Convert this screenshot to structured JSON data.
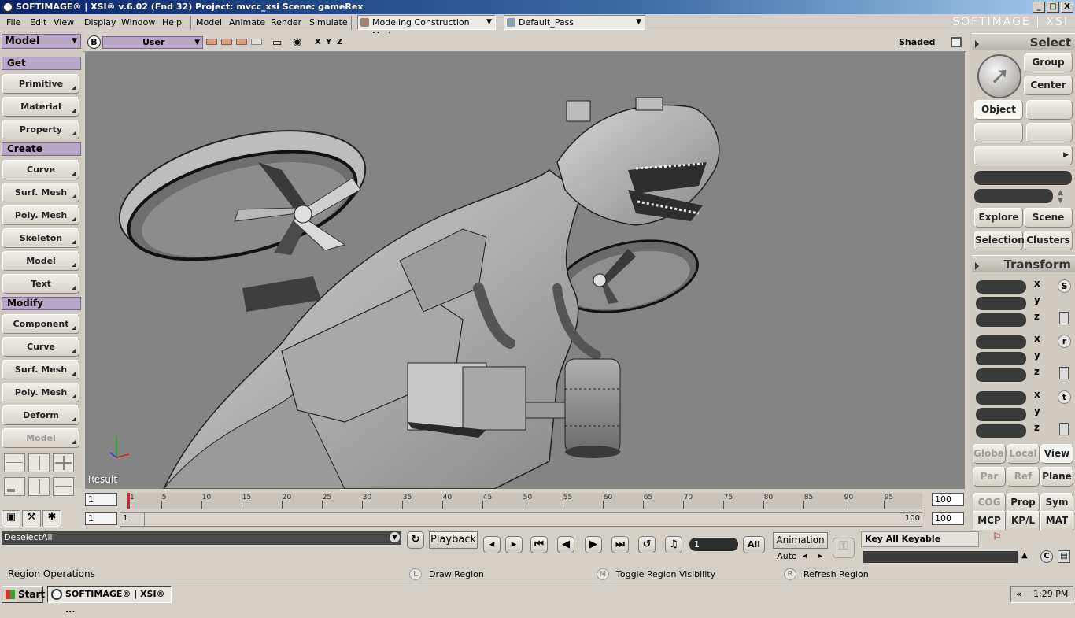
{
  "window": {
    "title": "SOFTIMAGE® | XSI® v.6.02 (Fnd 32) Project: mvcc_xsi    Scene: gameRex",
    "logo": "SOFTIMAGE | XSI",
    "minimize": "_",
    "maximize": "□",
    "close": "X"
  },
  "menubar": {
    "items": [
      "File",
      "Edit",
      "View",
      "Display",
      "Window",
      "Help",
      "Model",
      "Animate",
      "Render",
      "Simulate"
    ],
    "mode": "Modeling Construction Mode",
    "pass": "Default_Pass"
  },
  "left_panel": {
    "module": "Model",
    "sections": {
      "get": "Get",
      "create": "Create",
      "modify": "Modify"
    },
    "get_items": [
      "Primitive",
      "Material",
      "Property"
    ],
    "create_items": [
      "Curve",
      "Surf. Mesh",
      "Poly. Mesh",
      "Skeleton",
      "Model",
      "Text"
    ],
    "modify_items": [
      "Component",
      "Curve",
      "Surf. Mesh",
      "Poly. Mesh",
      "Deform",
      "Model"
    ]
  },
  "viewport": {
    "badge": "B",
    "camera": "User",
    "axes": [
      "X",
      "Y",
      "Z"
    ],
    "display_mode": "Shaded",
    "result_label": "Result"
  },
  "right_panel": {
    "select_title": "Select",
    "group": "Group",
    "center": "Center",
    "object": "Object",
    "explore": "Explore",
    "scene": "Scene",
    "selection": "Selection",
    "clusters": "Clusters",
    "transform_title": "Transform",
    "axes": [
      "x",
      "y",
      "z"
    ],
    "scale_icon": "S",
    "rotate_icon": "r",
    "translate_icon": "t",
    "global": "Global",
    "local": "Local",
    "view": "View",
    "par": "Par",
    "ref": "Ref",
    "plane": "Plane",
    "cog": "COG",
    "prop": "Prop",
    "sym": "Sym",
    "mcp": "MCP",
    "kpl": "KP/L",
    "mat": "MAT"
  },
  "timeline": {
    "start_frame": "1",
    "current_frame": "1",
    "end_frame": "100",
    "range_start": "1",
    "range_end": "100",
    "range_field_end": "100",
    "ticks": [
      "1",
      "5",
      "10",
      "15",
      "20",
      "25",
      "30",
      "35",
      "40",
      "45",
      "50",
      "55",
      "60",
      "65",
      "70",
      "75",
      "80",
      "85",
      "90",
      "95"
    ]
  },
  "controls": {
    "command": "DeselectAll",
    "playback": "Playback",
    "frame_value": "1",
    "all": "All",
    "animation": "Animation",
    "auto": "Auto",
    "key_all": "Key All Keyable"
  },
  "status": {
    "region_ops": "Region Operations",
    "l_key": "L",
    "l_label": "Draw Region",
    "m_key": "M",
    "m_label": "Toggle Region Visibility",
    "r_key": "R",
    "r_label": "Refresh Region"
  },
  "taskbar": {
    "start": "Start",
    "task": "SOFTIMAGE® | XSI® ...",
    "chevron": "«",
    "time": "1:29 PM"
  }
}
